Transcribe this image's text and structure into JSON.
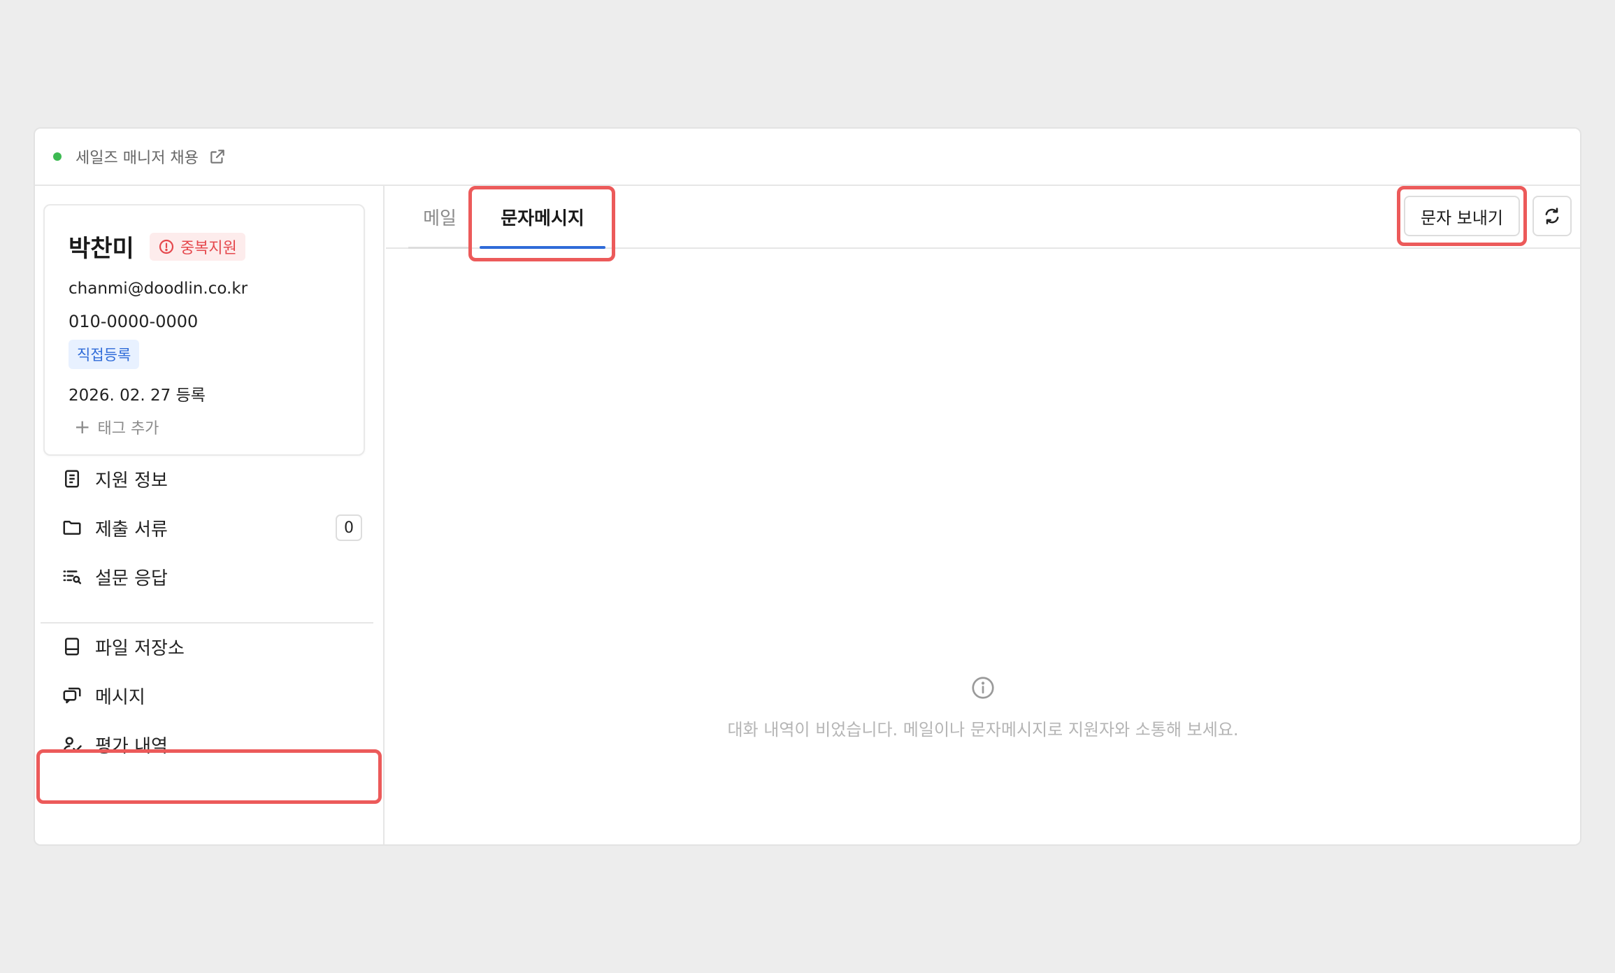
{
  "topbar": {
    "job_title": "세일즈 매니저 채용",
    "status_color": "#3dba52"
  },
  "candidate": {
    "name": "박찬미",
    "duplicate_badge": "중복지원",
    "email": "chanmi@doodlin.co.kr",
    "phone": "010-0000-0000",
    "source_badge": "직접등록",
    "registered": "2026. 02. 27  등록",
    "add_tag": "태그 추가"
  },
  "sidebar": {
    "items": [
      {
        "label": "지원 정보",
        "icon": "document-icon"
      },
      {
        "label": "제출 서류",
        "icon": "folder-icon",
        "count": "0"
      },
      {
        "label": "설문 응답",
        "icon": "survey-list-icon"
      },
      {
        "label": "파일 저장소",
        "icon": "storage-icon"
      },
      {
        "label": "메시지",
        "icon": "chat-icon",
        "selected": true
      },
      {
        "label": "평가 내역",
        "icon": "evaluation-icon"
      }
    ]
  },
  "tabs": [
    {
      "label": "메일",
      "active": false
    },
    {
      "label": "문자메시지",
      "active": true
    }
  ],
  "toolbar": {
    "send_label": "문자 보내기"
  },
  "empty_state": {
    "message": "대화 내역이 비었습니다. 메일이나 문자메시지로 지원자와 소통해 보세요."
  },
  "colors": {
    "highlight": "#ec5a5a",
    "accent": "#2f6bd8",
    "danger": "#e5484d"
  }
}
